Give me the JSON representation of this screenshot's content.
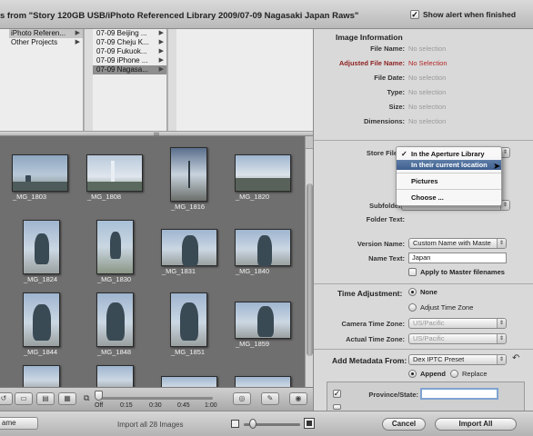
{
  "window": {
    "title": "s from \"Story 120GB USB/iPhoto Referenced Library 2009/07-09 Nagasaki Japan Raws\"",
    "alert_label": "Show alert when finished",
    "alert_checked": true
  },
  "browser": {
    "col1": [
      "iPhoto Referen...",
      "Other Projects"
    ],
    "col2": [
      "07-09 Beijing ...",
      "07-09 Cheju K...",
      "07-09 Fukuok...",
      "07-09 iPhone ...",
      "07-09 Nagasa..."
    ]
  },
  "thumbnails": [
    {
      "caption": "_MG_1803"
    },
    {
      "caption": "_MG_1808"
    },
    {
      "caption": "_MG_1816"
    },
    {
      "caption": "_MG_1820"
    },
    {
      "caption": "_MG_1824"
    },
    {
      "caption": "_MG_1830"
    },
    {
      "caption": "_MG_1831"
    },
    {
      "caption": "_MG_1840"
    },
    {
      "caption": "_MG_1844"
    },
    {
      "caption": "_MG_1848"
    },
    {
      "caption": "_MG_1851"
    },
    {
      "caption": "_MG_1859"
    }
  ],
  "grid_toolbar": {
    "ticks": [
      "Off",
      "0:15",
      "0:30",
      "0:45",
      "1:00"
    ]
  },
  "statusbar": {
    "left_popup": "ame",
    "import_text": "Import all 28 Images",
    "cancel_label": "Cancel",
    "import_label": "Import All"
  },
  "image_info": {
    "header": "Image Information",
    "rows": [
      {
        "label": "File Name:",
        "value": "No selection"
      },
      {
        "label": "Adjusted File Name:",
        "value": "No Selection"
      },
      {
        "label": "File Date:",
        "value": "No selection"
      },
      {
        "label": "Type:",
        "value": "No selection"
      },
      {
        "label": "Size:",
        "value": "No selection"
      },
      {
        "label": "Dimensions:",
        "value": "No selection"
      }
    ]
  },
  "store": {
    "store_label": "Store File",
    "subfolders_label": "Subfolder",
    "folder_text_label": "Folder Text:",
    "version_name_label": "Version Name:",
    "version_name_value": "Custom Name with Maste",
    "name_text_label": "Name Text:",
    "name_text_value": "Japan",
    "apply_label": "Apply to Master filenames"
  },
  "store_menu": {
    "items": [
      "In the Aperture Library",
      "In their current location",
      "Pictures",
      "Choose ..."
    ],
    "checked": "In the Aperture Library",
    "highlighted": "In their current location"
  },
  "time": {
    "header": "Time Adjustment:",
    "none_label": "None",
    "adjust_label": "Adjust Time Zone",
    "camera_label": "Camera Time Zone:",
    "camera_value": "US/Pacific",
    "actual_label": "Actual Time Zone:",
    "actual_value": "US/Pacific"
  },
  "metadata": {
    "header": "Add Metadata From:",
    "preset": "Dex IPTC Preset",
    "append_label": "Append",
    "replace_label": "Replace",
    "province_label": "Province/State:"
  }
}
